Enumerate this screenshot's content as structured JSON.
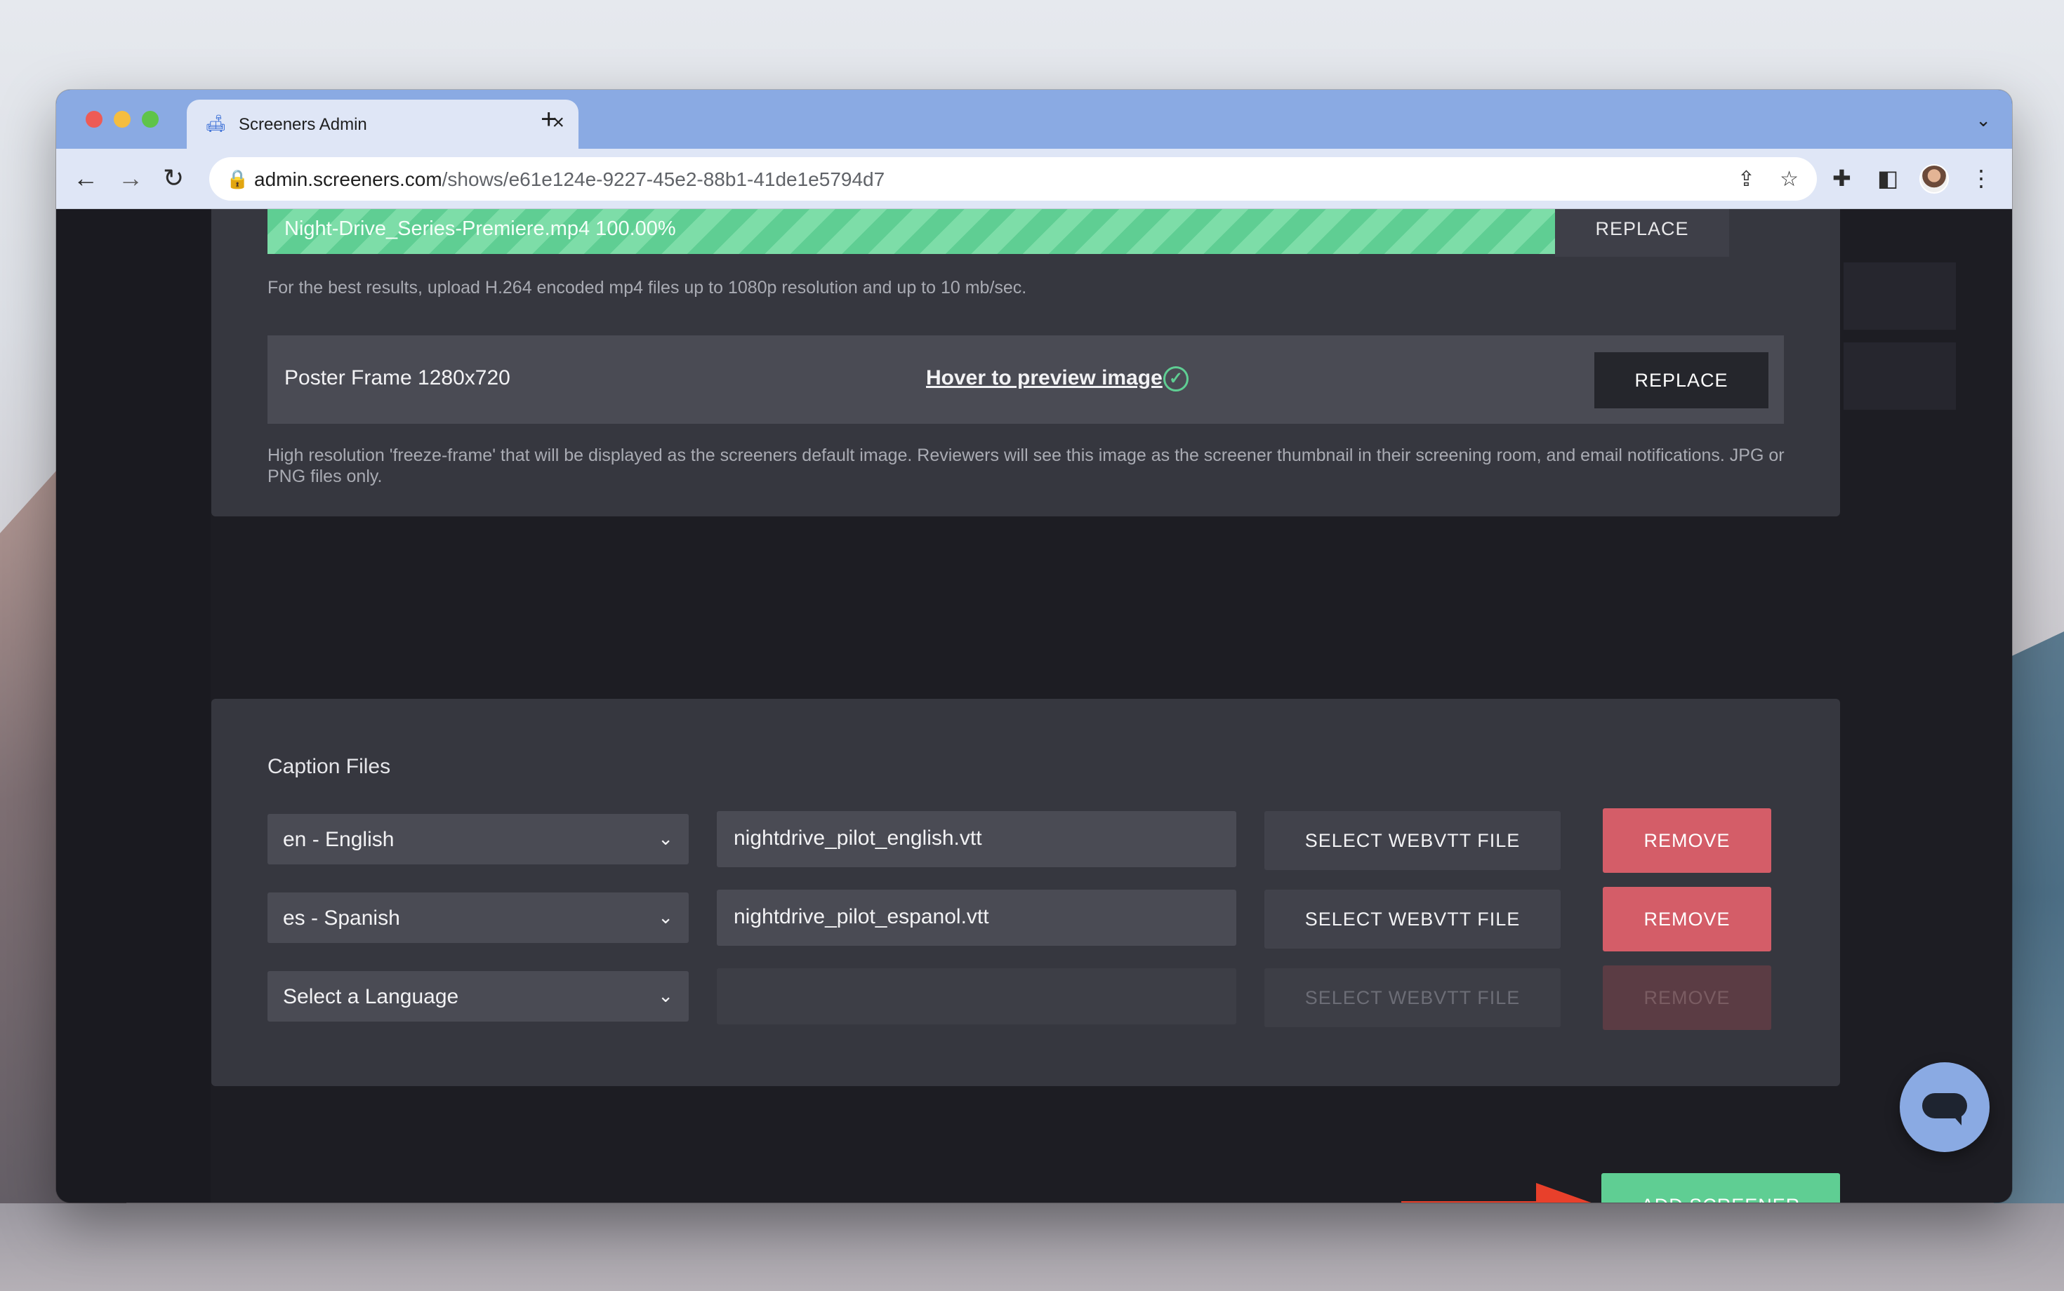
{
  "browser": {
    "tab_title": "Screeners Admin",
    "tab_close": "×",
    "new_tab": "+",
    "url_host": "admin.screeners.com",
    "url_path": "/shows/e61e124e-9227-45e2-88b1-41de1e5794d7"
  },
  "video_upload": {
    "progress_label": "Night-Drive_Series-Premiere.mp4 100.00%",
    "progress_fraction": 1.0,
    "replace_label": "REPLACE",
    "hint": "For the best results, upload H.264 encoded mp4 files up to 1080p resolution and up to 10 mb/sec."
  },
  "poster": {
    "label": "Poster Frame 1280x720",
    "preview_link": "Hover to preview image",
    "replace_label": "REPLACE",
    "hint": "High resolution 'freeze-frame' that will be displayed as the screeners default image. Reviewers will see this image as the screener thumbnail in their screening room, and email notifications. JPG or PNG files only."
  },
  "captions": {
    "title": "Caption Files",
    "rows": [
      {
        "language": "en - English",
        "file": "nightdrive_pilot_english.vtt",
        "select_label": "SELECT WEBVTT FILE",
        "remove_label": "REMOVE"
      },
      {
        "language": "es - Spanish",
        "file": "nightdrive_pilot_espanol.vtt",
        "select_label": "SELECT WEBVTT FILE",
        "remove_label": "REMOVE"
      },
      {
        "language": "Select a Language",
        "file": "",
        "select_label": "SELECT WEBVTT FILE",
        "remove_label": "REMOVE"
      }
    ]
  },
  "actions": {
    "add_screener_label": "ADD SCREENER"
  },
  "colors": {
    "accent_green": "#5fce93",
    "remove_red": "#d45d68",
    "chat_blue": "#8aaae3",
    "annotation_arrow": "#e8402b"
  }
}
